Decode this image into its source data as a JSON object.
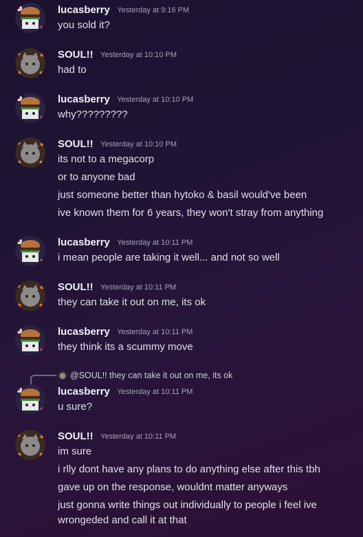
{
  "users": {
    "lucas": "lucasberry",
    "soul": "SOUL!!"
  },
  "messages": [
    {
      "author": "lucasberry",
      "time": "Yesterday at 9:16 PM",
      "lines": [
        "you sold it?"
      ]
    },
    {
      "author": "SOUL!!",
      "time": "Yesterday at 10:10 PM",
      "lines": [
        "had to"
      ]
    },
    {
      "author": "lucasberry",
      "time": "Yesterday at 10:10 PM",
      "lines": [
        "why?????????"
      ]
    },
    {
      "author": "SOUL!!",
      "time": "Yesterday at 10:10 PM",
      "lines": [
        "its not to a megacorp",
        "or to anyone bad",
        "just someone better than hytoko & basil would've been",
        "ive known them for 6 years, they won't stray from anything"
      ]
    },
    {
      "author": "lucasberry",
      "time": "Yesterday at 10:11 PM",
      "lines": [
        "i mean people are taking it well... and not so well"
      ]
    },
    {
      "author": "SOUL!!",
      "time": "Yesterday at 10:11 PM",
      "lines": [
        "they can take it out on me, its ok"
      ]
    },
    {
      "author": "lucasberry",
      "time": "Yesterday at 10:11 PM",
      "lines": [
        "they think its a scummy move"
      ]
    },
    {
      "author": "lucasberry",
      "time": "Yesterday at 10:11 PM",
      "lines": [
        "u sure?"
      ],
      "reply": {
        "mention": "@SOUL!!",
        "text": "they can take it out on me, its ok"
      }
    },
    {
      "author": "SOUL!!",
      "time": "Yesterday at 10:11 PM",
      "lines": [
        "im sure",
        "i rlly dont have any plans to do anything else after this tbh",
        "gave up on the response, wouldnt matter anyways",
        "just gonna write things out individually to people i feel ive",
        "wrongeded and call it at that"
      ]
    }
  ],
  "colors": {
    "background": "#1e1433",
    "author": "#f2f0f7",
    "timestamp": "#a7a2b8",
    "text": "#e2deea"
  },
  "icons": [
    "burger-avatar-icon",
    "cat-avatar-icon"
  ]
}
